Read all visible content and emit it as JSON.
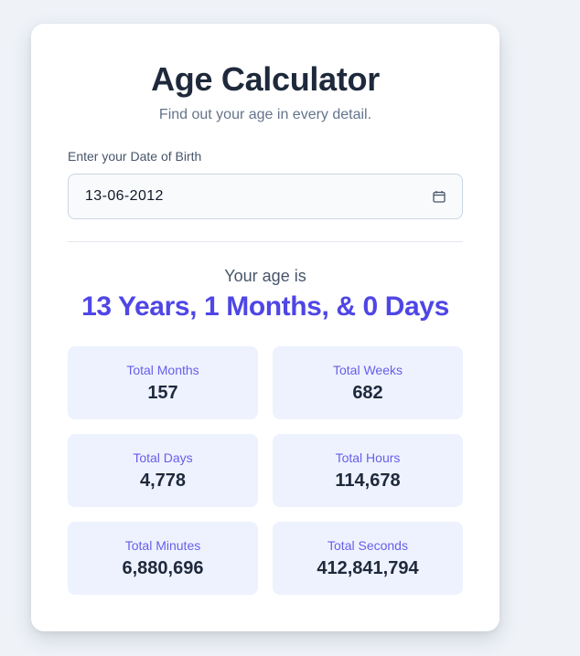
{
  "header": {
    "title": "Age Calculator",
    "subtitle": "Find out your age in every detail."
  },
  "form": {
    "dob_label": "Enter your Date of Birth",
    "dob_value": "13-06-2012",
    "calendar_icon": "calendar-icon"
  },
  "result": {
    "label": "Your age is",
    "summary": "13 Years, 1 Months, & 0 Days"
  },
  "stats": [
    {
      "label": "Total Months",
      "value": "157"
    },
    {
      "label": "Total Weeks",
      "value": "682"
    },
    {
      "label": "Total Days",
      "value": "4,778"
    },
    {
      "label": "Total Hours",
      "value": "114,678"
    },
    {
      "label": "Total Minutes",
      "value": "6,880,696"
    },
    {
      "label": "Total Seconds",
      "value": "412,841,794"
    }
  ],
  "colors": {
    "accent": "#4f46e5",
    "stat_background": "#eef2ff",
    "page_background": "#eff3f8"
  }
}
